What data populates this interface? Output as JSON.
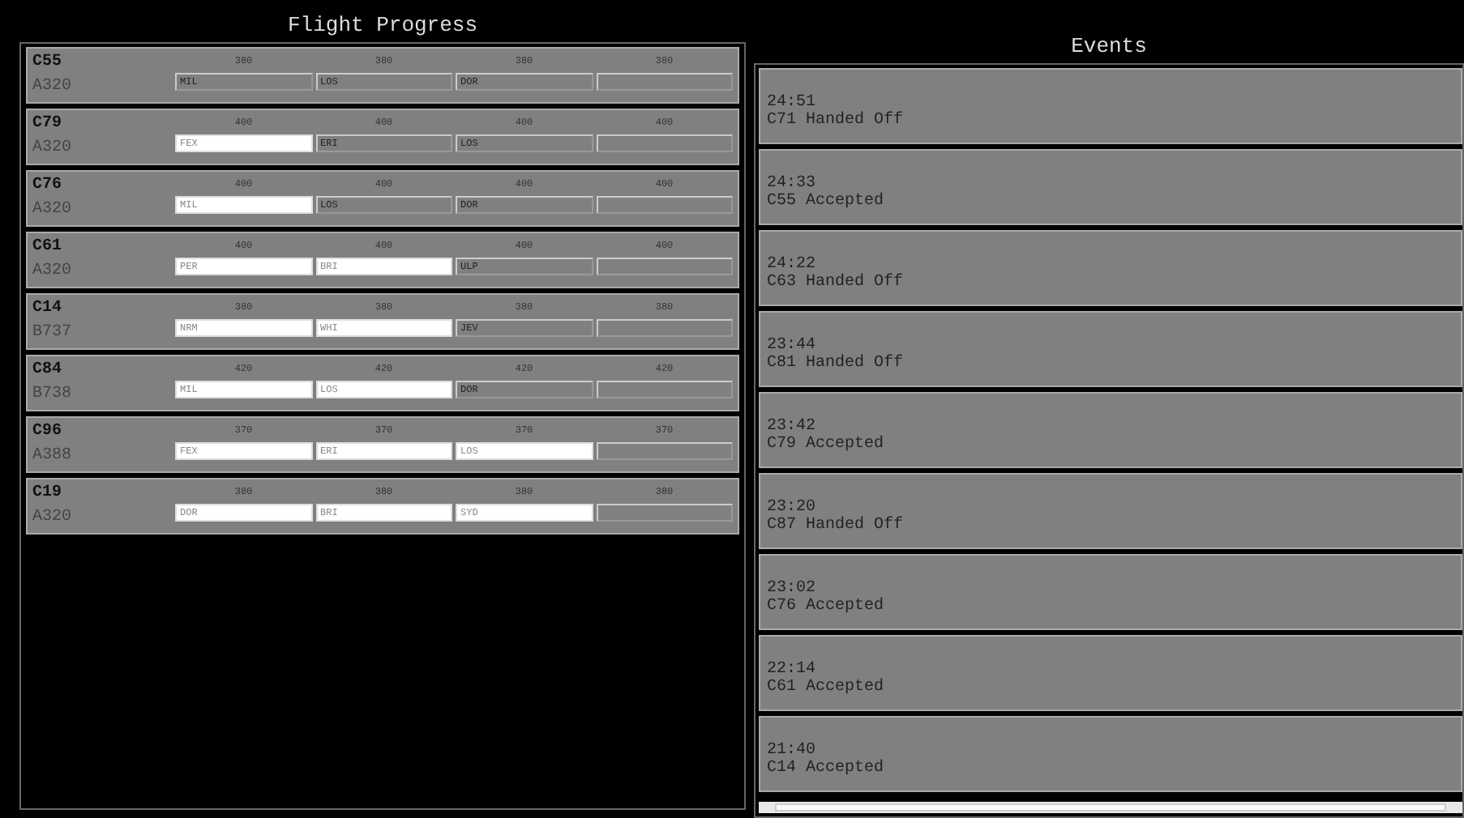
{
  "flight_progress": {
    "title": "Flight Progress",
    "strips": [
      {
        "callsign": "C55",
        "aircraft": "A320",
        "altitudes": [
          "380",
          "380",
          "380",
          "380"
        ],
        "fixes": [
          {
            "name": "MIL",
            "passed": false
          },
          {
            "name": "LOS",
            "passed": false
          },
          {
            "name": "DOR",
            "passed": false
          }
        ]
      },
      {
        "callsign": "C79",
        "aircraft": "A320",
        "altitudes": [
          "400",
          "400",
          "400",
          "400"
        ],
        "fixes": [
          {
            "name": "FEX",
            "passed": true
          },
          {
            "name": "ERI",
            "passed": false
          },
          {
            "name": "LOS",
            "passed": false
          }
        ]
      },
      {
        "callsign": "C76",
        "aircraft": "A320",
        "altitudes": [
          "400",
          "400",
          "400",
          "400"
        ],
        "fixes": [
          {
            "name": "MIL",
            "passed": true
          },
          {
            "name": "LOS",
            "passed": false
          },
          {
            "name": "DOR",
            "passed": false
          }
        ]
      },
      {
        "callsign": "C61",
        "aircraft": "A320",
        "altitudes": [
          "400",
          "400",
          "400",
          "400"
        ],
        "fixes": [
          {
            "name": "PER",
            "passed": true
          },
          {
            "name": "BRI",
            "passed": true
          },
          {
            "name": "ULP",
            "passed": false
          }
        ]
      },
      {
        "callsign": "C14",
        "aircraft": "B737",
        "altitudes": [
          "380",
          "380",
          "380",
          "380"
        ],
        "fixes": [
          {
            "name": "NRM",
            "passed": true
          },
          {
            "name": "WHI",
            "passed": true
          },
          {
            "name": "JEV",
            "passed": false
          }
        ]
      },
      {
        "callsign": "C84",
        "aircraft": "B738",
        "altitudes": [
          "420",
          "420",
          "420",
          "420"
        ],
        "fixes": [
          {
            "name": "MIL",
            "passed": true
          },
          {
            "name": "LOS",
            "passed": true
          },
          {
            "name": "DOR",
            "passed": false
          }
        ]
      },
      {
        "callsign": "C96",
        "aircraft": "A388",
        "altitudes": [
          "370",
          "370",
          "370",
          "370"
        ],
        "fixes": [
          {
            "name": "FEX",
            "passed": true
          },
          {
            "name": "ERI",
            "passed": true
          },
          {
            "name": "LOS",
            "passed": true
          }
        ]
      },
      {
        "callsign": "C19",
        "aircraft": "A320",
        "altitudes": [
          "380",
          "380",
          "380",
          "380"
        ],
        "fixes": [
          {
            "name": "DOR",
            "passed": true
          },
          {
            "name": "BRI",
            "passed": true
          },
          {
            "name": "SYD",
            "passed": true
          }
        ]
      }
    ]
  },
  "events": {
    "title": "Events",
    "items": [
      {
        "time": "24:51",
        "text": "C71 Handed Off"
      },
      {
        "time": "24:33",
        "text": "C55 Accepted"
      },
      {
        "time": "24:22",
        "text": "C63 Handed Off"
      },
      {
        "time": "23:44",
        "text": "C81 Handed Off"
      },
      {
        "time": "23:42",
        "text": "C79 Accepted"
      },
      {
        "time": "23:20",
        "text": "C87 Handed Off"
      },
      {
        "time": "23:02",
        "text": "C76 Accepted"
      },
      {
        "time": "22:14",
        "text": "C61 Accepted"
      },
      {
        "time": "21:40",
        "text": "C14 Accepted"
      }
    ]
  }
}
